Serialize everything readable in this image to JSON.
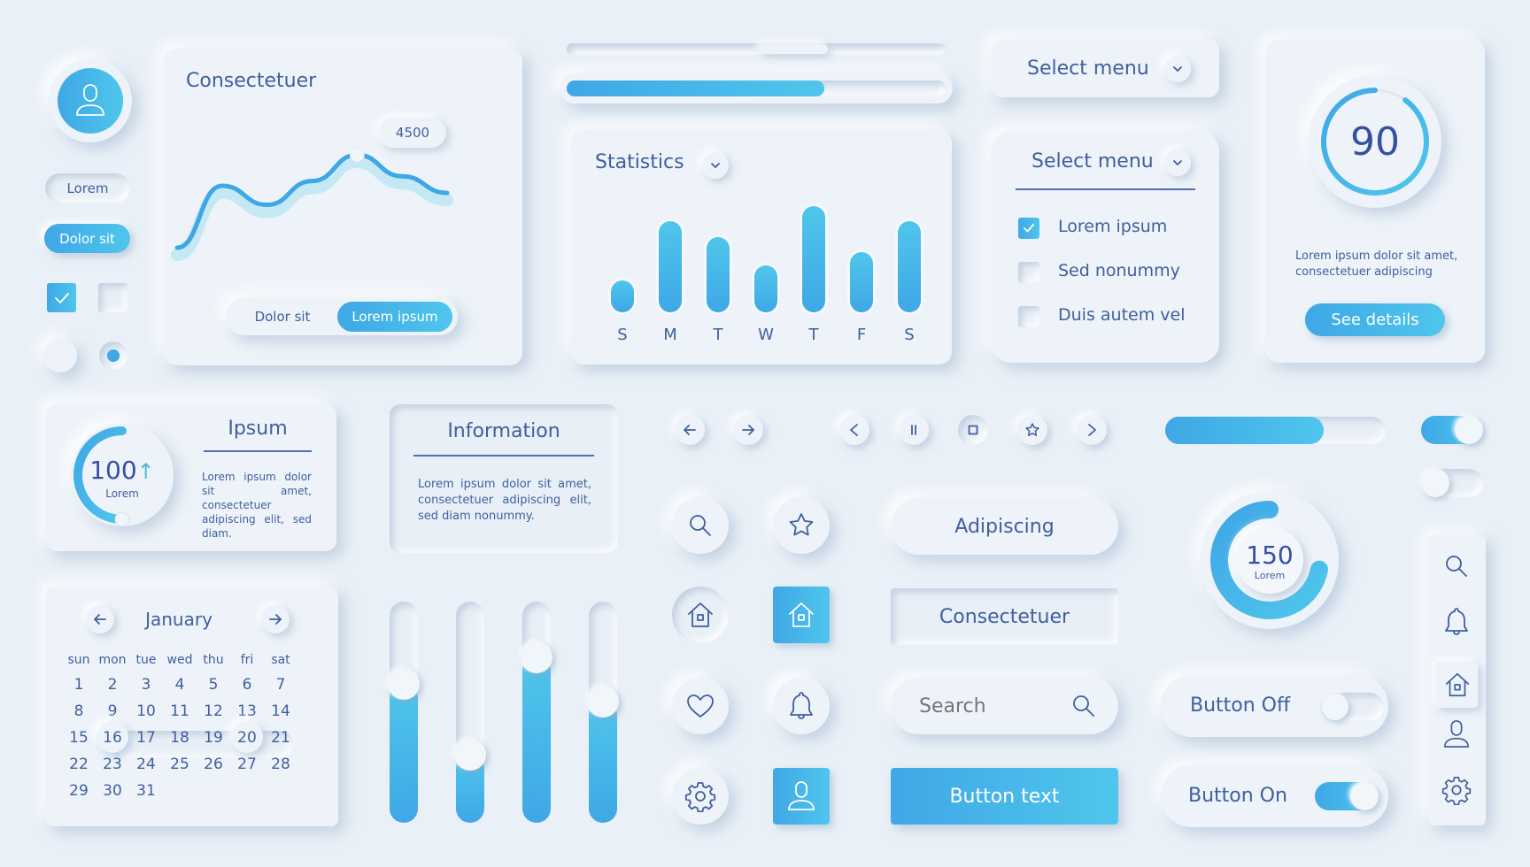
{
  "colors": {
    "background": "#e9f0f7",
    "accent": "#3fa7e6",
    "accent_light": "#4fc6ec",
    "text": "#3f5f9e"
  },
  "profile": {
    "avatar_icon": "user-icon",
    "chip_lorem": "Lorem",
    "chip_dolor": "Dolor sit",
    "checkbox_checked": true,
    "checkbox_unchecked": false,
    "radio_unselected": false,
    "radio_selected": true
  },
  "line_card": {
    "title": "Consectetuer",
    "tooltip_value": "4500",
    "segment_options": [
      "Dolor sit",
      "Lorem ipsum"
    ],
    "segment_selected": "Lorem ipsum"
  },
  "chart_data": {
    "type": "line",
    "title": "Consectetuer",
    "x": [
      0,
      1,
      2,
      3,
      4,
      5,
      6
    ],
    "values": [
      600,
      3200,
      2400,
      3400,
      4500,
      3600,
      2900
    ],
    "highlight": {
      "index": 4,
      "label": "4500"
    },
    "xlabel": "",
    "ylabel": "",
    "grid": false
  },
  "scrollbar": {
    "position": 0.62,
    "thumb_fraction": 0.18
  },
  "top_progress": {
    "value": 0.68
  },
  "statistics": {
    "title": "Statistics",
    "dropdown_icon": "chevron-down-icon",
    "bars": [
      {
        "day": "S",
        "value": 30
      },
      {
        "day": "M",
        "value": 86
      },
      {
        "day": "T",
        "value": 71
      },
      {
        "day": "W",
        "value": 44
      },
      {
        "day": "T",
        "value": 100
      },
      {
        "day": "F",
        "value": 57
      },
      {
        "day": "S",
        "value": 86
      }
    ],
    "max": 100
  },
  "select_menu_1": {
    "label": "Select menu"
  },
  "select_menu_2": {
    "label": "Select menu",
    "options": [
      {
        "label": "Lorem ipsum",
        "checked": true
      },
      {
        "label": "Sed nonummy",
        "checked": false
      },
      {
        "label": "Duis autem vel",
        "checked": false
      }
    ]
  },
  "score_card": {
    "value": "90",
    "progress": 0.9,
    "description_line1": "Lorem ipsum dolor sit amet,",
    "description_line2": "consectetuer adipiscing",
    "button": "See details"
  },
  "ipsum_card": {
    "gauge_value": "100",
    "gauge_arrow": "↑",
    "gauge_label": "Lorem",
    "gauge_progress": 0.5,
    "title": "Ipsum",
    "text": "Lorem ipsum dolor sit amet, consectetuer adipiscing elit, sed diam."
  },
  "info_card": {
    "title": "Information",
    "text": "Lorem ipsum dolor sit amet, consectetuer adipiscing elit, sed diam nonummy."
  },
  "nav_buttons": [
    "arrow-left-icon",
    "arrow-right-icon"
  ],
  "media_buttons": [
    "chevron-left-icon",
    "pause-icon",
    "stop-icon",
    "star-icon",
    "chevron-right-icon"
  ],
  "icon_grid": [
    {
      "icon": "search-icon",
      "style": "round"
    },
    {
      "icon": "star-icon",
      "style": "round"
    },
    {
      "icon": "home-icon",
      "style": "round"
    },
    {
      "icon": "home-icon",
      "style": "blue-square"
    },
    {
      "icon": "heart-icon",
      "style": "round"
    },
    {
      "icon": "bell-icon",
      "style": "round"
    },
    {
      "icon": "gear-icon",
      "style": "round"
    },
    {
      "icon": "user-icon",
      "style": "blue-square"
    }
  ],
  "buttons": {
    "adipiscing": "Adipiscing",
    "consectetuer": "Consectetuer",
    "search_placeholder": "Search",
    "primary": "Button text"
  },
  "right_progress": {
    "value": 0.72
  },
  "toggles": {
    "top_on": true,
    "top_off": false
  },
  "gauge_150": {
    "value": "150",
    "label": "Lorem",
    "progress": 0.72
  },
  "switch_rows": [
    {
      "label": "Button Off",
      "on": false
    },
    {
      "label": "Button On",
      "on": true
    }
  ],
  "side_nav": {
    "items": [
      "search-icon",
      "bell-icon",
      "home-icon",
      "user-icon",
      "gear-icon"
    ],
    "active": "home-icon"
  },
  "sliders": [
    0.63,
    0.31,
    0.75,
    0.55
  ],
  "calendar": {
    "month": "January",
    "weekdays": [
      "sun",
      "mon",
      "tue",
      "wed",
      "thu",
      "fri",
      "sat"
    ],
    "weeks": [
      [
        "1",
        "2",
        "3",
        "4",
        "5",
        "6",
        "7"
      ],
      [
        "8",
        "9",
        "10",
        "11",
        "12",
        "13",
        "14"
      ],
      [
        "15",
        "16",
        "17",
        "18",
        "19",
        "20",
        "21"
      ],
      [
        "22",
        "23",
        "24",
        "25",
        "26",
        "27",
        "28"
      ],
      [
        "29",
        "30",
        "31",
        "",
        "",
        "",
        ""
      ]
    ],
    "range_start": "16",
    "range_end": "20"
  }
}
